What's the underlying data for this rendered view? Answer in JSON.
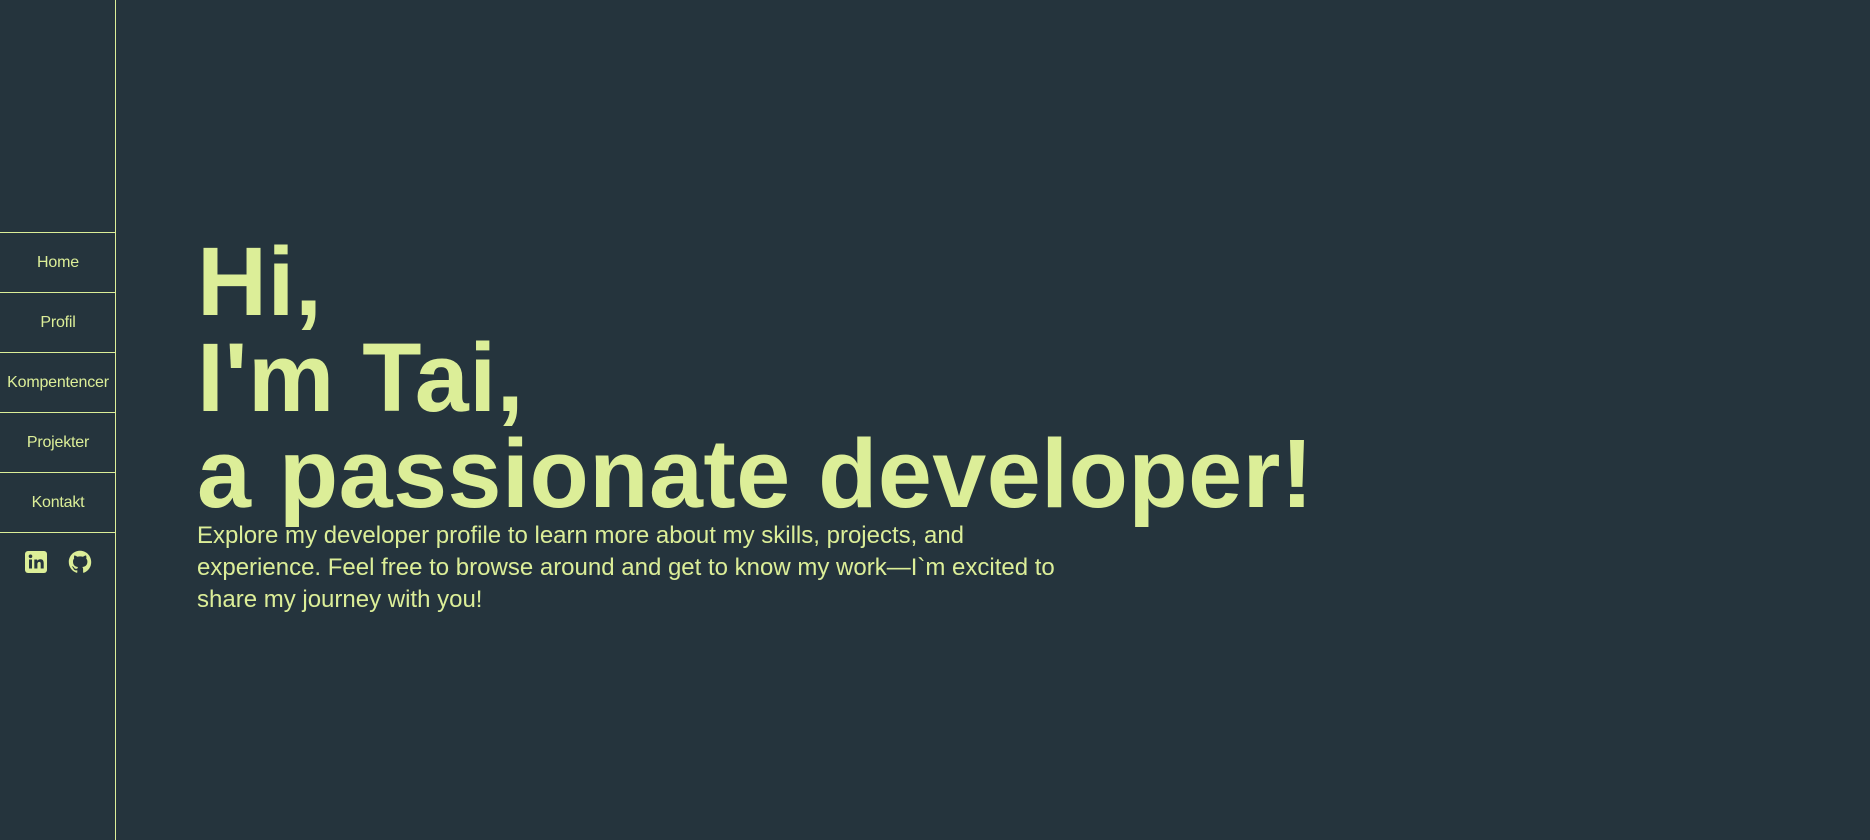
{
  "theme": {
    "background": "#25343d",
    "accent": "#dcee98"
  },
  "nav": {
    "items": [
      {
        "label": "Home"
      },
      {
        "label": "Profil"
      },
      {
        "label": "Kompentencer"
      },
      {
        "label": "Projekter"
      },
      {
        "label": "Kontakt"
      }
    ]
  },
  "socials": [
    {
      "icon": "linkedin-icon"
    },
    {
      "icon": "github-icon"
    }
  ],
  "hero": {
    "line1": "Hi,",
    "line2": "I'm Tai,",
    "line3": "a passionate developer!",
    "intro": "Explore my developer profile to learn more about my skills, projects, and experience. Feel free to browse around and get to know my work—I`m excited to share my journey with you!"
  }
}
